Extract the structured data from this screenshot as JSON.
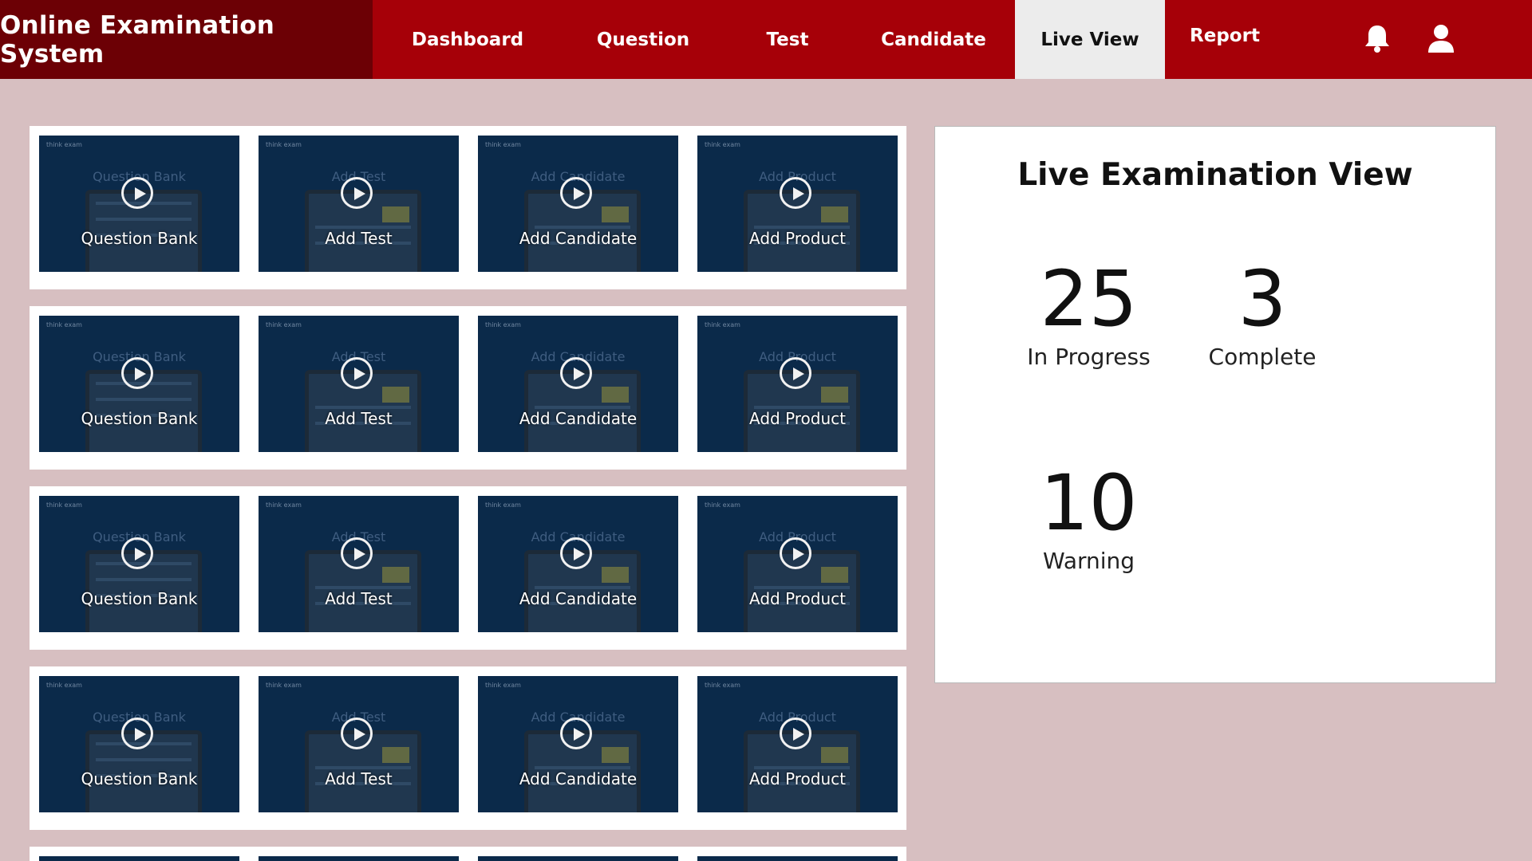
{
  "app": {
    "title": "Online Examination System"
  },
  "nav": {
    "items": [
      "Dashboard",
      "Question",
      "Test",
      "Candidate",
      "Live View",
      "Report"
    ],
    "active": "Live View",
    "icons": [
      "bell-icon",
      "user-icon"
    ]
  },
  "grid": {
    "tile_logo": "think exam",
    "columns": [
      "Question Bank",
      "Add Test",
      "Add Candidate",
      "Add Product"
    ],
    "rows": 5
  },
  "panel": {
    "title": "Live Examination View",
    "stats": [
      {
        "value": "25",
        "label": "In Progress"
      },
      {
        "value": "3",
        "label": "Complete"
      },
      {
        "value": "10",
        "label": "Warning"
      }
    ]
  },
  "colors": {
    "nav_bg": "#a60008",
    "brand_bg": "#6c0005",
    "page_bg": "#d7bfc1",
    "tile_bg": "#0b2a4a",
    "active_tab_bg": "#ececec"
  }
}
